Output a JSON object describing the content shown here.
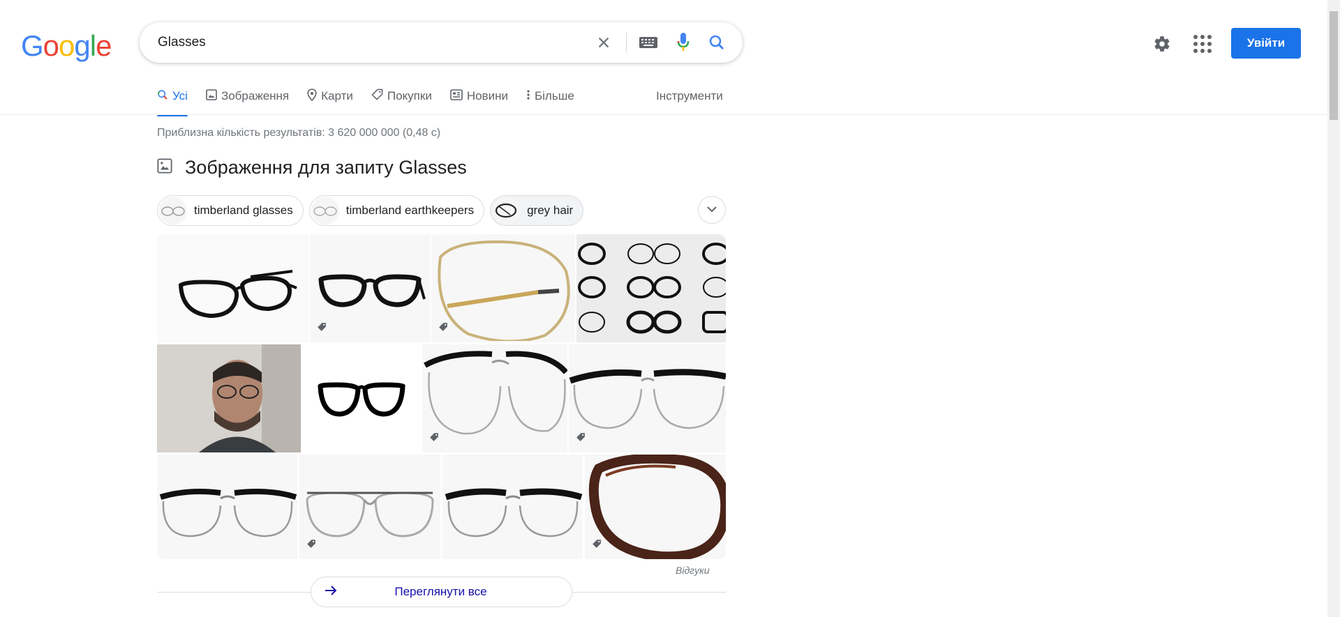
{
  "header": {
    "logo_letters": [
      {
        "ch": "G",
        "color": "#4285F4"
      },
      {
        "ch": "o",
        "color": "#EA4335"
      },
      {
        "ch": "o",
        "color": "#FBBC05"
      },
      {
        "ch": "g",
        "color": "#4285F4"
      },
      {
        "ch": "l",
        "color": "#34A853"
      },
      {
        "ch": "e",
        "color": "#EA4335"
      }
    ],
    "search_value": "Glasses",
    "signin_label": "Увійти"
  },
  "tabs": [
    {
      "label": "Усі",
      "icon": "search-icon",
      "active": true
    },
    {
      "label": "Зображення",
      "icon": "image-icon"
    },
    {
      "label": "Карти",
      "icon": "map-pin-icon"
    },
    {
      "label": "Покупки",
      "icon": "tag-icon"
    },
    {
      "label": "Новини",
      "icon": "news-icon"
    },
    {
      "label": "Більше",
      "icon": "more-vert-icon"
    }
  ],
  "tools_label": "Інструменти",
  "stats": "Приблизна кількість результатів: 3 620 000 000 (0,48 с)",
  "images_section": {
    "heading": "Зображення для запиту Glasses",
    "chips": [
      {
        "label": "timberland glasses"
      },
      {
        "label": "timberland earthkeepers"
      },
      {
        "label": "grey hair"
      }
    ],
    "feedback": "Відгуки",
    "see_all": "Переглянути все"
  },
  "colors": {
    "accent": "#1a73e8",
    "link": "#1a0dab"
  }
}
